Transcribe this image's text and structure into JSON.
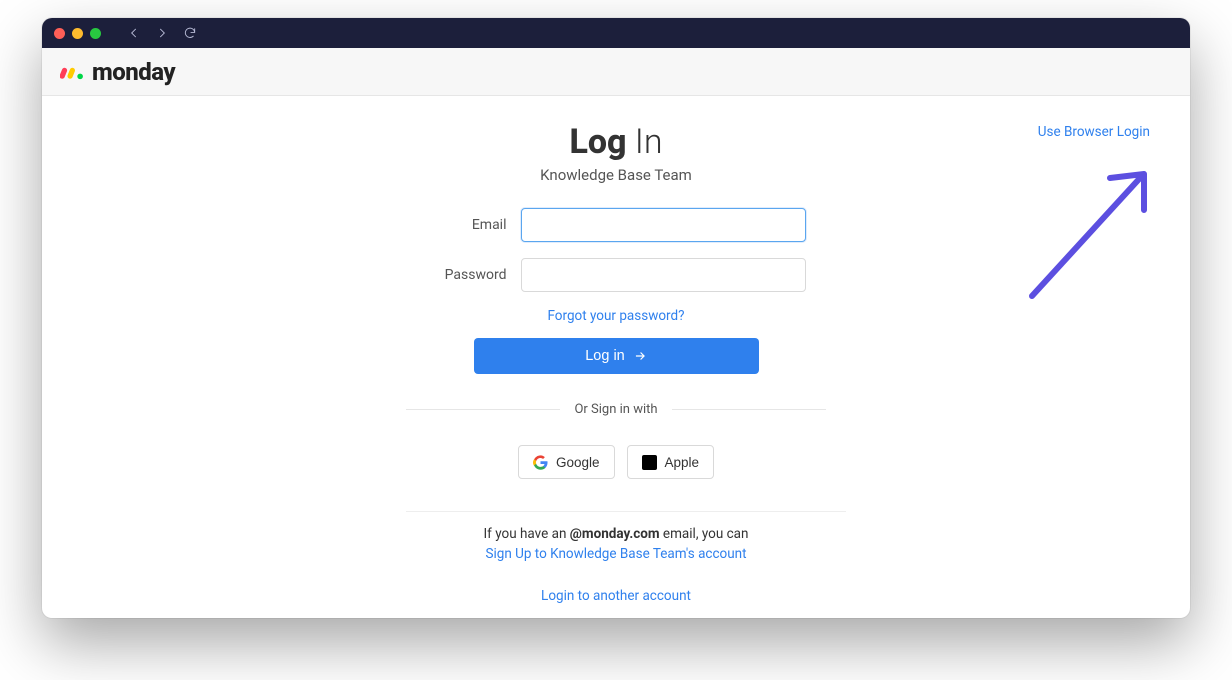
{
  "brand": "monday",
  "header_link": "Use Browser Login",
  "title_bold": "Log",
  "title_light": " In",
  "subtitle": "Knowledge Base Team",
  "fields": {
    "email_label": "Email",
    "email_value": "",
    "password_label": "Password",
    "password_value": ""
  },
  "forgot_link": "Forgot your password?",
  "login_button": "Log in",
  "divider": "Or Sign in with",
  "social": {
    "google": "Google",
    "apple": "Apple"
  },
  "helper_prefix": "If you have an ",
  "helper_bold": "@monday.com",
  "helper_suffix": " email, you can",
  "signup_link": "Sign Up to Knowledge Base Team's account",
  "another_account_link": "Login to another account",
  "colors": {
    "primary_blue": "#2f80ed",
    "titlebar": "#1c1f3b",
    "annotation": "#5c4fe0"
  }
}
